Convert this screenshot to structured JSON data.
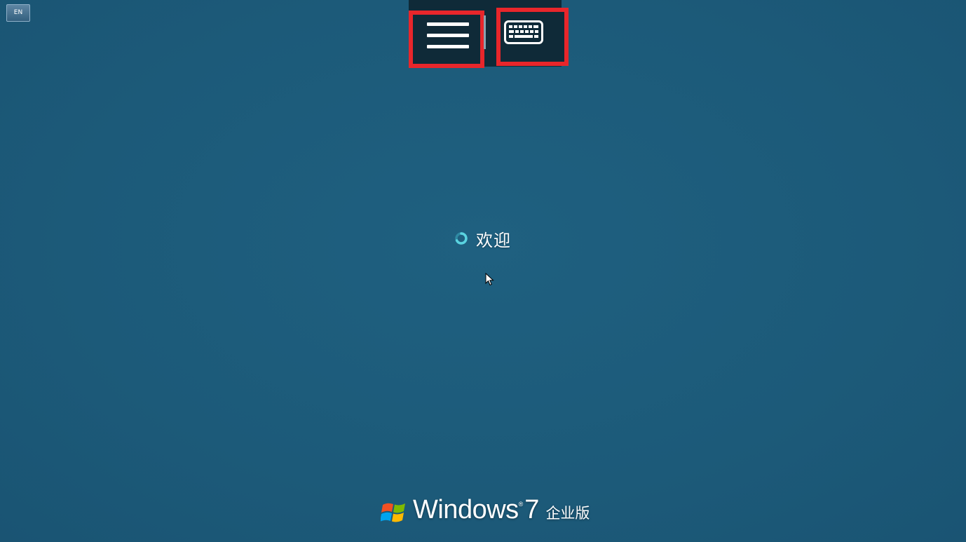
{
  "language_indicator": {
    "text": "EN",
    "icon": "keyboard-language-icon"
  },
  "toolbar": {
    "menu_button": {
      "icon": "hamburger-menu-icon",
      "highlight_color": "#e8262b"
    },
    "keyboard_button": {
      "icon": "keyboard-icon",
      "highlight_color": "#e8262b"
    }
  },
  "status": {
    "icon": "loading-spinner-icon",
    "text": "欢迎"
  },
  "branding": {
    "logo": "windows-flag-icon",
    "product": "Windows",
    "registered": "®",
    "version": "7",
    "edition": "企业版"
  },
  "colors": {
    "background": "#1d5b7a",
    "toolbar": "#0f2a38",
    "highlight": "#e8262b",
    "spinner": "#5ad3e0"
  }
}
